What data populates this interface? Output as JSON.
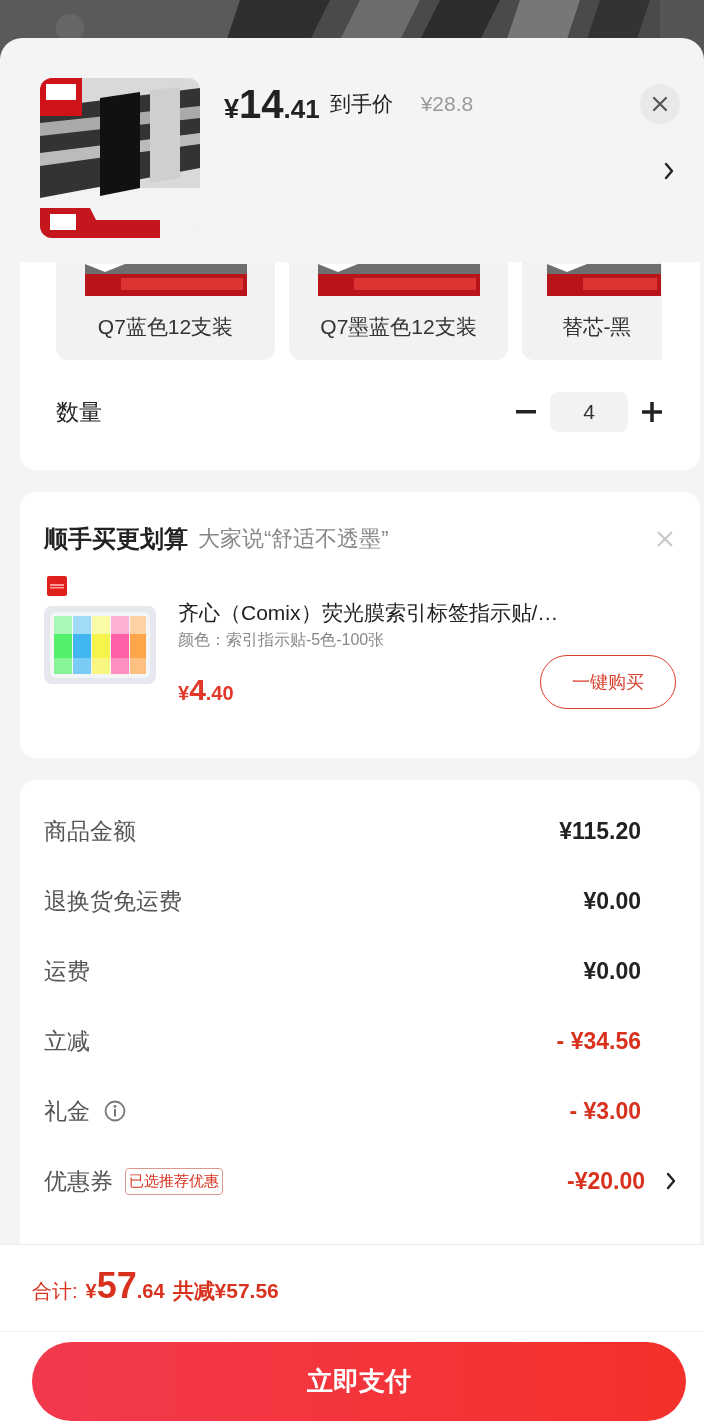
{
  "product": {
    "price": "¥14.41",
    "price_label": "到手价",
    "original_price": "¥28.8"
  },
  "variants": [
    {
      "label": "Q7蓝色12支装",
      "selected": false
    },
    {
      "label": "Q7墨蓝色12支装",
      "selected": false
    },
    {
      "label": "替芯-黑",
      "selected": false
    }
  ],
  "quantity": {
    "label": "数量",
    "value": "4"
  },
  "addon": {
    "title": "顺手买更划算",
    "subtitle": "大家说“舒适不透墨”",
    "item": {
      "name": "齐心（Comix）荧光膜索引标签指示贴/…",
      "spec": "颜色：索引指示贴-5色-100张",
      "price": "¥4.40",
      "button": "一键购买"
    }
  },
  "fees": [
    {
      "label": "商品金额",
      "value": "¥115.20",
      "kind": "normal"
    },
    {
      "label": "退换货免运费",
      "value": "¥0.00",
      "kind": "normal"
    },
    {
      "label": "运费",
      "value": "¥0.00",
      "kind": "normal"
    },
    {
      "label": "立减",
      "value": "- ¥34.56",
      "kind": "discount"
    },
    {
      "label": "礼金",
      "value": "- ¥3.00",
      "kind": "discount",
      "info": true
    },
    {
      "label": "优惠券",
      "value": "-¥20.00",
      "kind": "discount",
      "tag": "已选推荐优惠",
      "chevron": true
    }
  ],
  "footer": {
    "total_label": "合计:",
    "total": "¥57.64",
    "saved": "共减¥57.56",
    "pay_button": "立即支付"
  }
}
